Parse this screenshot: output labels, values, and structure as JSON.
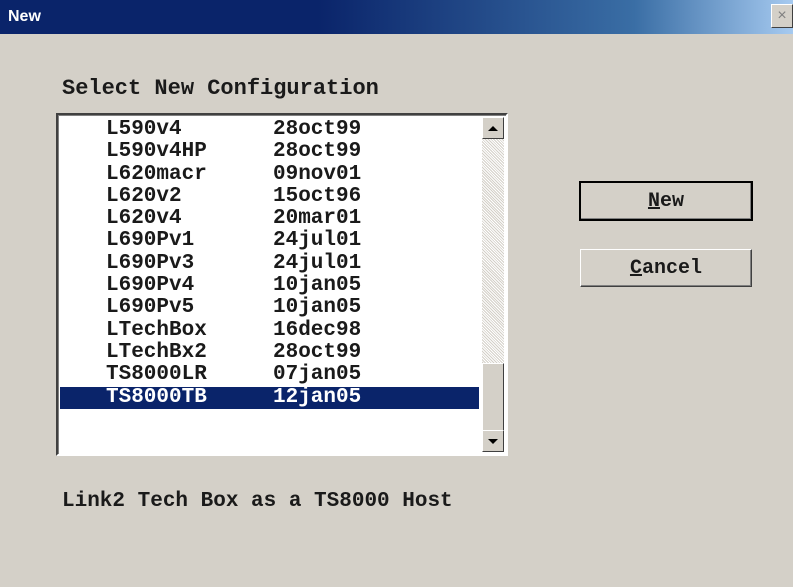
{
  "window": {
    "title": "New",
    "close_label": "×"
  },
  "list_label": "Select New Configuration",
  "configurations": [
    {
      "name": "L590v4",
      "date": "28oct99"
    },
    {
      "name": "L590v4HP",
      "date": "28oct99"
    },
    {
      "name": "L620macr",
      "date": "09nov01"
    },
    {
      "name": "L620v2",
      "date": "15oct96"
    },
    {
      "name": "L620v4",
      "date": "20mar01"
    },
    {
      "name": "L690Pv1",
      "date": "24jul01"
    },
    {
      "name": "L690Pv3",
      "date": "24jul01"
    },
    {
      "name": "L690Pv4",
      "date": "10jan05"
    },
    {
      "name": "L690Pv5",
      "date": "10jan05"
    },
    {
      "name": "LTechBox",
      "date": "16dec98"
    },
    {
      "name": "LTechBx2",
      "date": "28oct99"
    },
    {
      "name": "TS8000LR",
      "date": "07jan05"
    },
    {
      "name": "TS8000TB",
      "date": "12jan05"
    }
  ],
  "selected_index": 12,
  "buttons": {
    "new": {
      "mnemonic": "N",
      "rest": "ew"
    },
    "cancel": {
      "mnemonic": "C",
      "rest": "ancel"
    }
  },
  "description": "Link2 Tech Box as a TS8000 Host",
  "colors": {
    "title_bar": "#0a246a",
    "selection": "#0a246a",
    "face": "#d4d0c8"
  }
}
